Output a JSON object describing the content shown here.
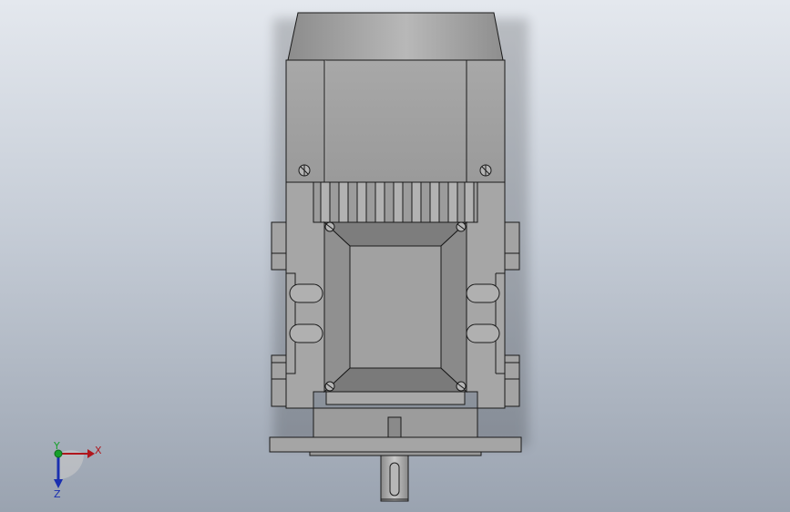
{
  "viewport": {
    "background_top": "#e4e8ee",
    "background_bottom": "#9aa3b0",
    "model_color": "#a3a3a3",
    "edge_color": "#1a1a1a"
  },
  "triad": {
    "x_label": "X",
    "y_label": "Y",
    "z_label": "Z",
    "x_color": "#b0161c",
    "y_color": "#16a02a",
    "z_color": "#1a2fb0"
  }
}
